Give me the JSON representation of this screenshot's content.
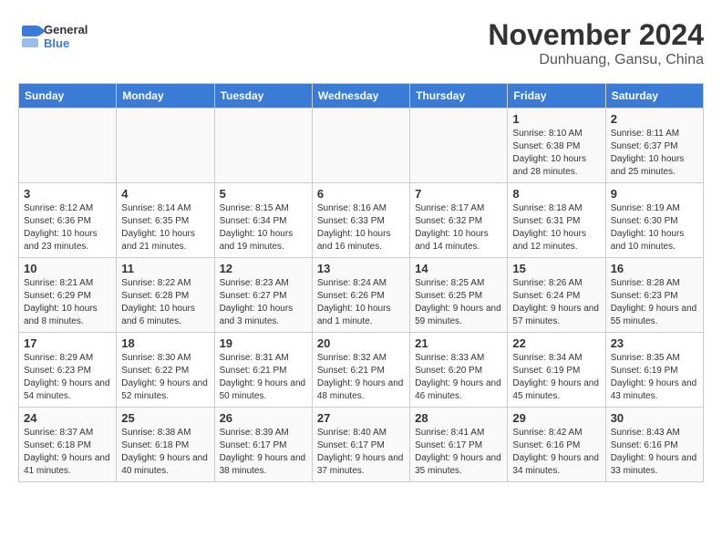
{
  "header": {
    "logo_general": "General",
    "logo_blue": "Blue",
    "month_title": "November 2024",
    "location": "Dunhuang, Gansu, China"
  },
  "days_of_week": [
    "Sunday",
    "Monday",
    "Tuesday",
    "Wednesday",
    "Thursday",
    "Friday",
    "Saturday"
  ],
  "weeks": [
    [
      {
        "day": "",
        "info": ""
      },
      {
        "day": "",
        "info": ""
      },
      {
        "day": "",
        "info": ""
      },
      {
        "day": "",
        "info": ""
      },
      {
        "day": "",
        "info": ""
      },
      {
        "day": "1",
        "info": "Sunrise: 8:10 AM\nSunset: 6:38 PM\nDaylight: 10 hours and 28 minutes."
      },
      {
        "day": "2",
        "info": "Sunrise: 8:11 AM\nSunset: 6:37 PM\nDaylight: 10 hours and 25 minutes."
      }
    ],
    [
      {
        "day": "3",
        "info": "Sunrise: 8:12 AM\nSunset: 6:36 PM\nDaylight: 10 hours and 23 minutes."
      },
      {
        "day": "4",
        "info": "Sunrise: 8:14 AM\nSunset: 6:35 PM\nDaylight: 10 hours and 21 minutes."
      },
      {
        "day": "5",
        "info": "Sunrise: 8:15 AM\nSunset: 6:34 PM\nDaylight: 10 hours and 19 minutes."
      },
      {
        "day": "6",
        "info": "Sunrise: 8:16 AM\nSunset: 6:33 PM\nDaylight: 10 hours and 16 minutes."
      },
      {
        "day": "7",
        "info": "Sunrise: 8:17 AM\nSunset: 6:32 PM\nDaylight: 10 hours and 14 minutes."
      },
      {
        "day": "8",
        "info": "Sunrise: 8:18 AM\nSunset: 6:31 PM\nDaylight: 10 hours and 12 minutes."
      },
      {
        "day": "9",
        "info": "Sunrise: 8:19 AM\nSunset: 6:30 PM\nDaylight: 10 hours and 10 minutes."
      }
    ],
    [
      {
        "day": "10",
        "info": "Sunrise: 8:21 AM\nSunset: 6:29 PM\nDaylight: 10 hours and 8 minutes."
      },
      {
        "day": "11",
        "info": "Sunrise: 8:22 AM\nSunset: 6:28 PM\nDaylight: 10 hours and 6 minutes."
      },
      {
        "day": "12",
        "info": "Sunrise: 8:23 AM\nSunset: 6:27 PM\nDaylight: 10 hours and 3 minutes."
      },
      {
        "day": "13",
        "info": "Sunrise: 8:24 AM\nSunset: 6:26 PM\nDaylight: 10 hours and 1 minute."
      },
      {
        "day": "14",
        "info": "Sunrise: 8:25 AM\nSunset: 6:25 PM\nDaylight: 9 hours and 59 minutes."
      },
      {
        "day": "15",
        "info": "Sunrise: 8:26 AM\nSunset: 6:24 PM\nDaylight: 9 hours and 57 minutes."
      },
      {
        "day": "16",
        "info": "Sunrise: 8:28 AM\nSunset: 6:23 PM\nDaylight: 9 hours and 55 minutes."
      }
    ],
    [
      {
        "day": "17",
        "info": "Sunrise: 8:29 AM\nSunset: 6:23 PM\nDaylight: 9 hours and 54 minutes."
      },
      {
        "day": "18",
        "info": "Sunrise: 8:30 AM\nSunset: 6:22 PM\nDaylight: 9 hours and 52 minutes."
      },
      {
        "day": "19",
        "info": "Sunrise: 8:31 AM\nSunset: 6:21 PM\nDaylight: 9 hours and 50 minutes."
      },
      {
        "day": "20",
        "info": "Sunrise: 8:32 AM\nSunset: 6:21 PM\nDaylight: 9 hours and 48 minutes."
      },
      {
        "day": "21",
        "info": "Sunrise: 8:33 AM\nSunset: 6:20 PM\nDaylight: 9 hours and 46 minutes."
      },
      {
        "day": "22",
        "info": "Sunrise: 8:34 AM\nSunset: 6:19 PM\nDaylight: 9 hours and 45 minutes."
      },
      {
        "day": "23",
        "info": "Sunrise: 8:35 AM\nSunset: 6:19 PM\nDaylight: 9 hours and 43 minutes."
      }
    ],
    [
      {
        "day": "24",
        "info": "Sunrise: 8:37 AM\nSunset: 6:18 PM\nDaylight: 9 hours and 41 minutes."
      },
      {
        "day": "25",
        "info": "Sunrise: 8:38 AM\nSunset: 6:18 PM\nDaylight: 9 hours and 40 minutes."
      },
      {
        "day": "26",
        "info": "Sunrise: 8:39 AM\nSunset: 6:17 PM\nDaylight: 9 hours and 38 minutes."
      },
      {
        "day": "27",
        "info": "Sunrise: 8:40 AM\nSunset: 6:17 PM\nDaylight: 9 hours and 37 minutes."
      },
      {
        "day": "28",
        "info": "Sunrise: 8:41 AM\nSunset: 6:17 PM\nDaylight: 9 hours and 35 minutes."
      },
      {
        "day": "29",
        "info": "Sunrise: 8:42 AM\nSunset: 6:16 PM\nDaylight: 9 hours and 34 minutes."
      },
      {
        "day": "30",
        "info": "Sunrise: 8:43 AM\nSunset: 6:16 PM\nDaylight: 9 hours and 33 minutes."
      }
    ]
  ]
}
